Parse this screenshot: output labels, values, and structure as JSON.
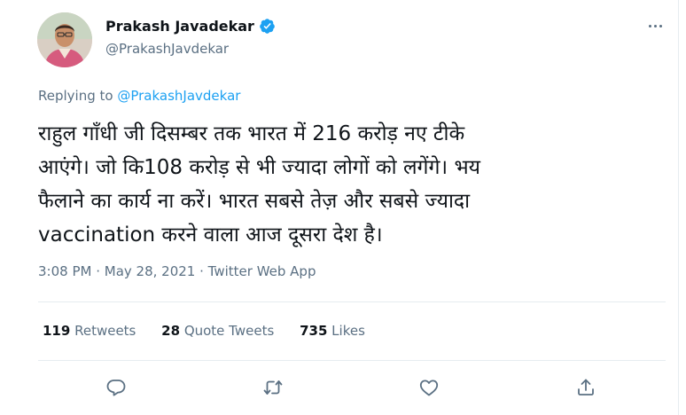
{
  "author": {
    "name": "Prakash Javadekar",
    "handle": "@PrakashJavdekar"
  },
  "reply": {
    "prefix": "Replying to ",
    "handle": "@PrakashJavdekar"
  },
  "tweet": {
    "lines": [
      "राहुल गाँधी जी दिसम्बर तक भारत में 216  करोड़ नए टीके",
      "आएंगे। जो कि108 करोड़ से भी ज्यादा लोगों को लगेंगे। भय",
      "फैलाने का कार्य ना करें। भारत सबसे तेज़ और सबसे ज्यादा",
      "vaccination करने वाला आज दूसरा देश है।"
    ]
  },
  "meta": {
    "time": "3:08 PM",
    "sep1": " · ",
    "date": "May 28, 2021",
    "sep2": " · ",
    "source": "Twitter Web App"
  },
  "stats": {
    "retweets_count": "119",
    "retweets_label": "Retweets",
    "quotes_count": "28",
    "quotes_label": "Quote Tweets",
    "likes_count": "735",
    "likes_label": "Likes"
  },
  "colors": {
    "accent": "#1da1f2",
    "secondary_text": "#5b7083",
    "divider": "#e6ecf0"
  },
  "icons": [
    "verified-badge-icon",
    "more-icon",
    "reply-icon",
    "retweet-icon",
    "like-icon",
    "share-icon"
  ]
}
